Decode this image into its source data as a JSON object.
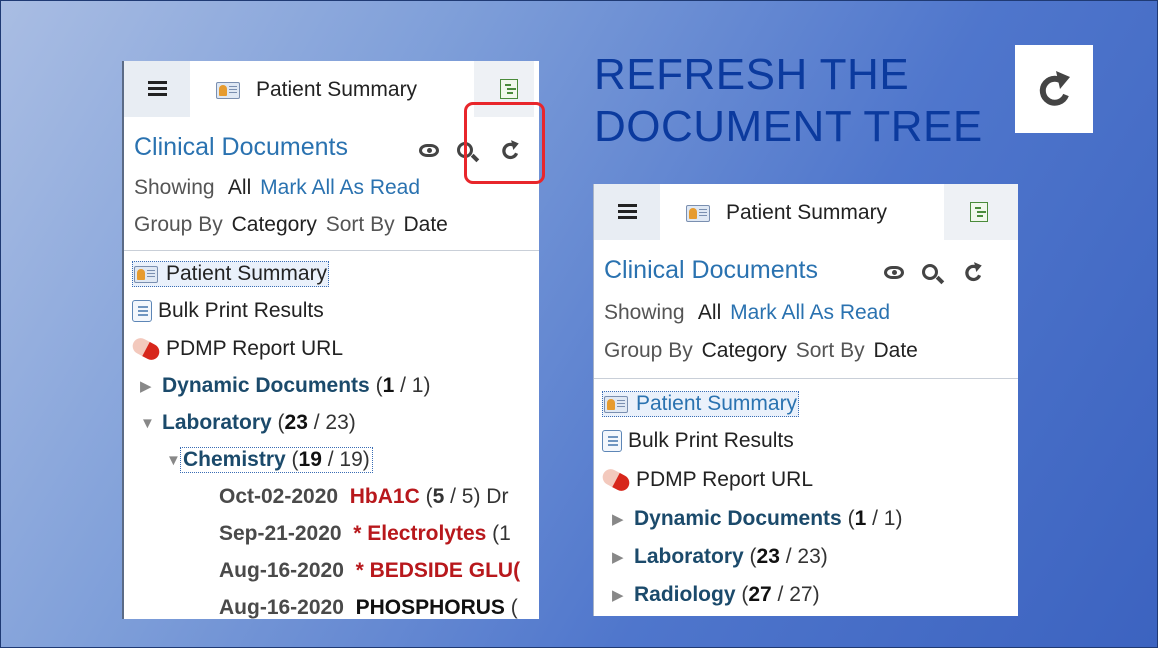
{
  "slide": {
    "title_line1": "REFRESH THE",
    "title_line2": "DOCUMENT TREE"
  },
  "colors": {
    "accent_blue": "#2a72b0",
    "category_blue": "#1b4a6b",
    "highlight_red": "#e8262b",
    "abnormal_red": "#b8181c"
  },
  "panel": {
    "tab_label": "Patient Summary",
    "section_title": "Clinical Documents",
    "showing_label": "Showing",
    "showing_value": "All",
    "mark_all_label": "Mark All As Read",
    "group_by_label": "Group By",
    "group_by_value": "Category",
    "sort_by_label": "Sort By",
    "sort_by_value": "Date",
    "tree_items": {
      "patient_summary": "Patient Summary",
      "bulk_print": "Bulk Print Results",
      "pdmp": "PDMP Report URL"
    }
  },
  "left_tree": {
    "dynamic": {
      "name": "Dynamic Documents",
      "open": "(",
      "unread": "1",
      "total": " / 1)"
    },
    "laboratory": {
      "name": "Laboratory",
      "open": "(",
      "unread": "23",
      "total": " / 23)"
    },
    "chemistry": {
      "name": "Chemistry",
      "open": "(",
      "unread": "19",
      "total": " / 19)"
    },
    "docs": [
      {
        "date": "Oct-02-2020",
        "name": "HbA1C",
        "count_open": " (",
        "unread": "5",
        "rest": " / 5) Dr"
      },
      {
        "date": "Sep-21-2020",
        "name": "* Electrolytes",
        "rest": " (1"
      },
      {
        "date": "Aug-16-2020",
        "name": "* BEDSIDE GLU(",
        "rest": ""
      },
      {
        "date": "Aug-16-2020",
        "name": "PHOSPHORUS",
        "rest": " ("
      }
    ]
  },
  "right_tree": {
    "dynamic": {
      "name": "Dynamic Documents",
      "open": "(",
      "unread": "1",
      "total": " / 1)"
    },
    "laboratory": {
      "name": "Laboratory",
      "open": "(",
      "unread": "23",
      "total": " / 23)"
    },
    "radiology": {
      "name": "Radiology",
      "open": "(",
      "unread": "27",
      "total": " / 27)"
    }
  }
}
